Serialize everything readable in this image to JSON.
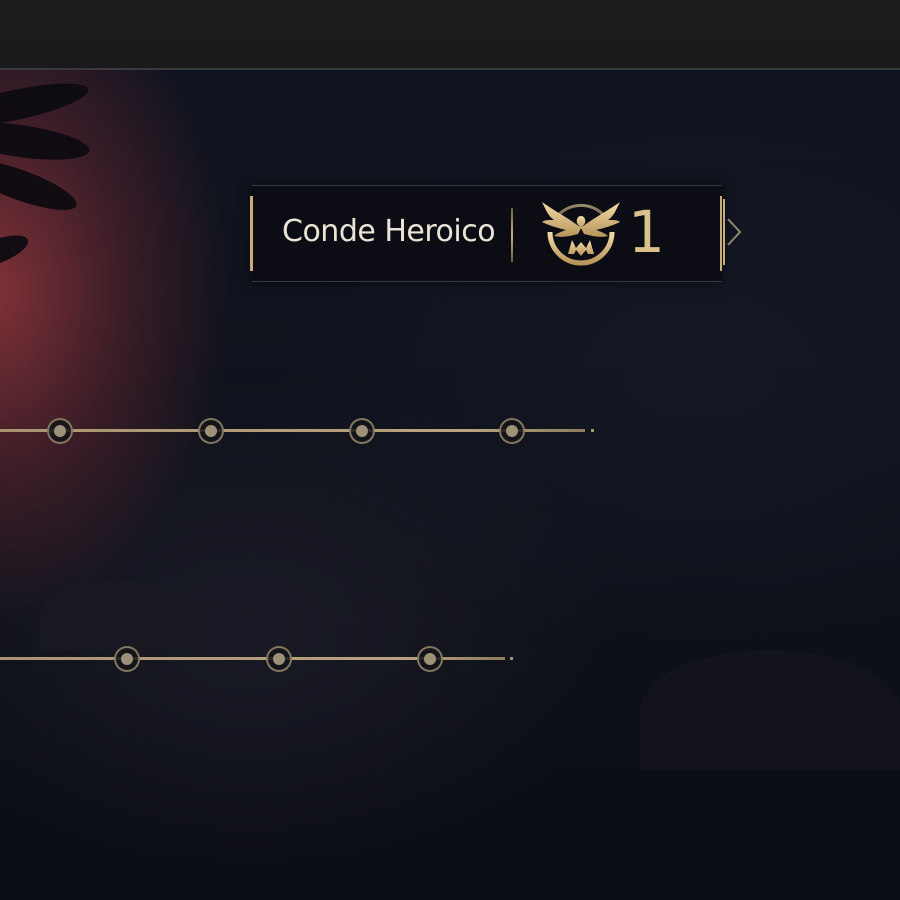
{
  "rank": {
    "name": "Conde Heroico",
    "level": "1",
    "emblem_icon": "eagle-emblem-icon"
  },
  "next_arrow_icon": "chevron-right-icon",
  "tracks": [
    {
      "node_count": 4,
      "node_icon": "milestone-node-icon"
    },
    {
      "node_count": 3,
      "node_icon": "milestone-node-icon"
    }
  ],
  "colors": {
    "accent_gold": "#c9ad78",
    "panel_bg": "#0c0d14",
    "text": "#eae4d6"
  }
}
